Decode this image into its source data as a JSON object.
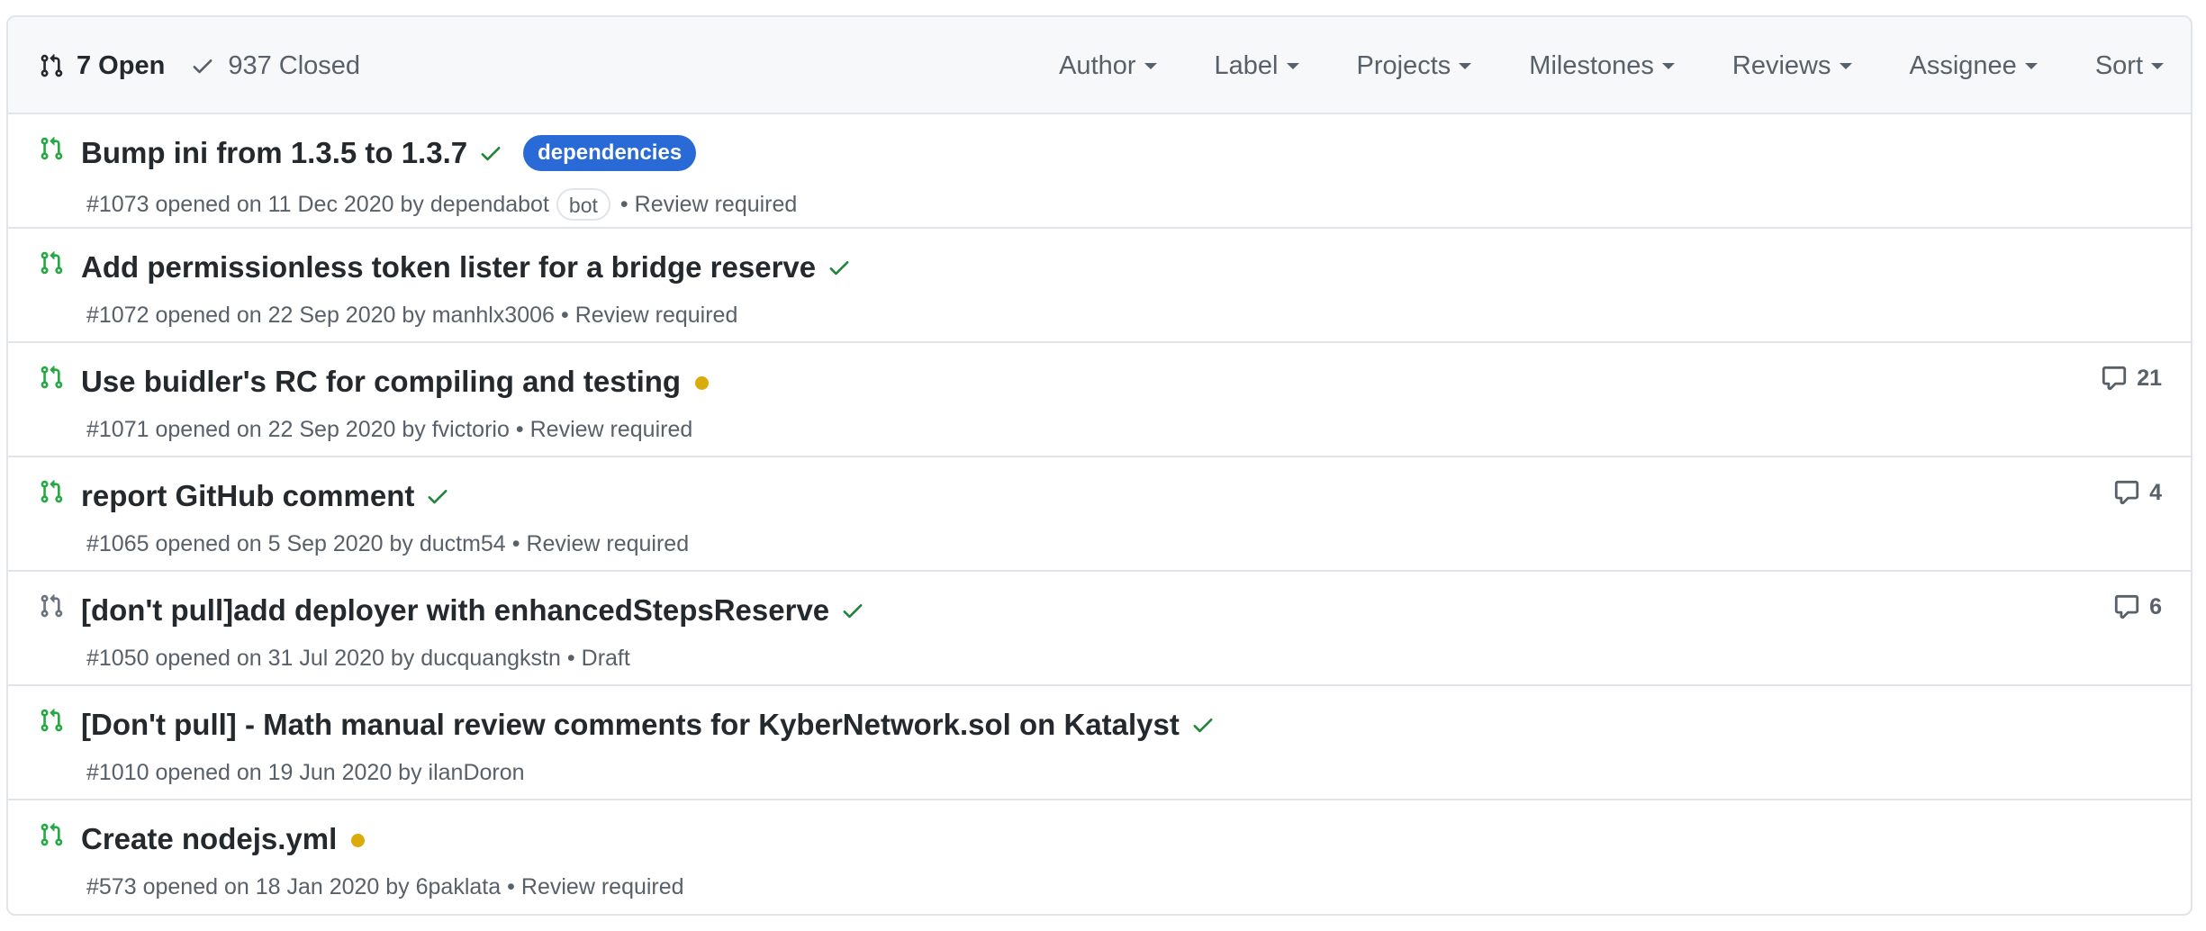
{
  "header": {
    "open_count_label": "7 Open",
    "closed_count_label": "937 Closed",
    "filters": [
      "Author",
      "Label",
      "Projects",
      "Milestones",
      "Reviews",
      "Assignee",
      "Sort"
    ]
  },
  "colors": {
    "open_icon": "#28a745",
    "draft_icon": "#6a737d",
    "success_check": "#22863a",
    "pending_dot": "#dbab09",
    "label_dependencies": "#2a6ad6"
  },
  "pull_requests": [
    {
      "title": "Bump ini from 1.3.5 to 1.3.7",
      "status_icon": "check-icon",
      "label": "dependencies",
      "number": "#1073",
      "opened_text": "opened on 11 Dec 2020 by",
      "author": "dependabot",
      "author_badge": "bot",
      "review": "Review required",
      "comments": ""
    },
    {
      "title": "Add permissionless token lister for a bridge reserve",
      "status_icon": "check-icon",
      "number": "#1072",
      "opened_text": "opened on 22 Sep 2020 by",
      "author": "manhlx3006",
      "review": "Review required",
      "comments": ""
    },
    {
      "title": "Use buidler's RC for compiling and testing",
      "status_icon": "pending-dot-icon",
      "number": "#1071",
      "opened_text": "opened on 22 Sep 2020 by",
      "author": "fvictorio",
      "review": "Review required",
      "comments": "21"
    },
    {
      "title": "report GitHub comment",
      "status_icon": "check-icon",
      "number": "#1065",
      "opened_text": "opened on 5 Sep 2020 by",
      "author": "ductm54",
      "review": "Review required",
      "comments": "4"
    },
    {
      "title": "[don't pull]add deployer with enhancedStepsReserve",
      "status_icon": "check-icon",
      "number": "#1050",
      "opened_text": "opened on 31 Jul 2020 by",
      "author": "ducquangkstn",
      "review": "Draft",
      "comments": "6",
      "draft": true
    },
    {
      "title": "[Don't pull] - Math manual review comments for KyberNetwork.sol on Katalyst",
      "status_icon": "check-icon",
      "number": "#1010",
      "opened_text": "opened on 19 Jun 2020 by",
      "author": "ilanDoron",
      "review": "",
      "comments": ""
    },
    {
      "title": "Create nodejs.yml",
      "status_icon": "pending-dot-icon",
      "number": "#573",
      "opened_text": "opened on 18 Jan 2020 by",
      "author": "6paklata",
      "review": "Review required",
      "comments": ""
    }
  ]
}
